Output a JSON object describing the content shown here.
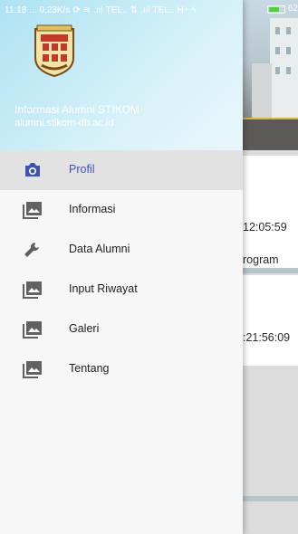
{
  "status_bar": {
    "time": "11:18",
    "net_speed": "... 0,23K/s",
    "carrier1": "TEL..",
    "carrier2": "TEL..",
    "network_type": "H+",
    "battery_level": "62"
  },
  "drawer": {
    "header": {
      "title": "Informasi Alumni STIKOM",
      "subtitle": "alumni.stikom-db.ac.id"
    },
    "items": [
      {
        "label": "Profil",
        "icon": "camera-icon",
        "active": true
      },
      {
        "label": "Informasi",
        "icon": "gallery-icon",
        "active": false
      },
      {
        "label": "Data Alumni",
        "icon": "wrench-icon",
        "active": false
      },
      {
        "label": "Input Riwayat",
        "icon": "gallery-icon",
        "active": false
      },
      {
        "label": "Galeri",
        "icon": "gallery-icon",
        "active": false
      },
      {
        "label": "Tentang",
        "icon": "gallery-icon",
        "active": false
      }
    ]
  },
  "background": {
    "card1_time": "12:05:59",
    "card1_text": "rogram",
    "card2_time": ":21:56:09"
  },
  "colors": {
    "accent": "#3f51b5",
    "icon": "#616161",
    "header_gradient_start": "#aee2f3"
  }
}
